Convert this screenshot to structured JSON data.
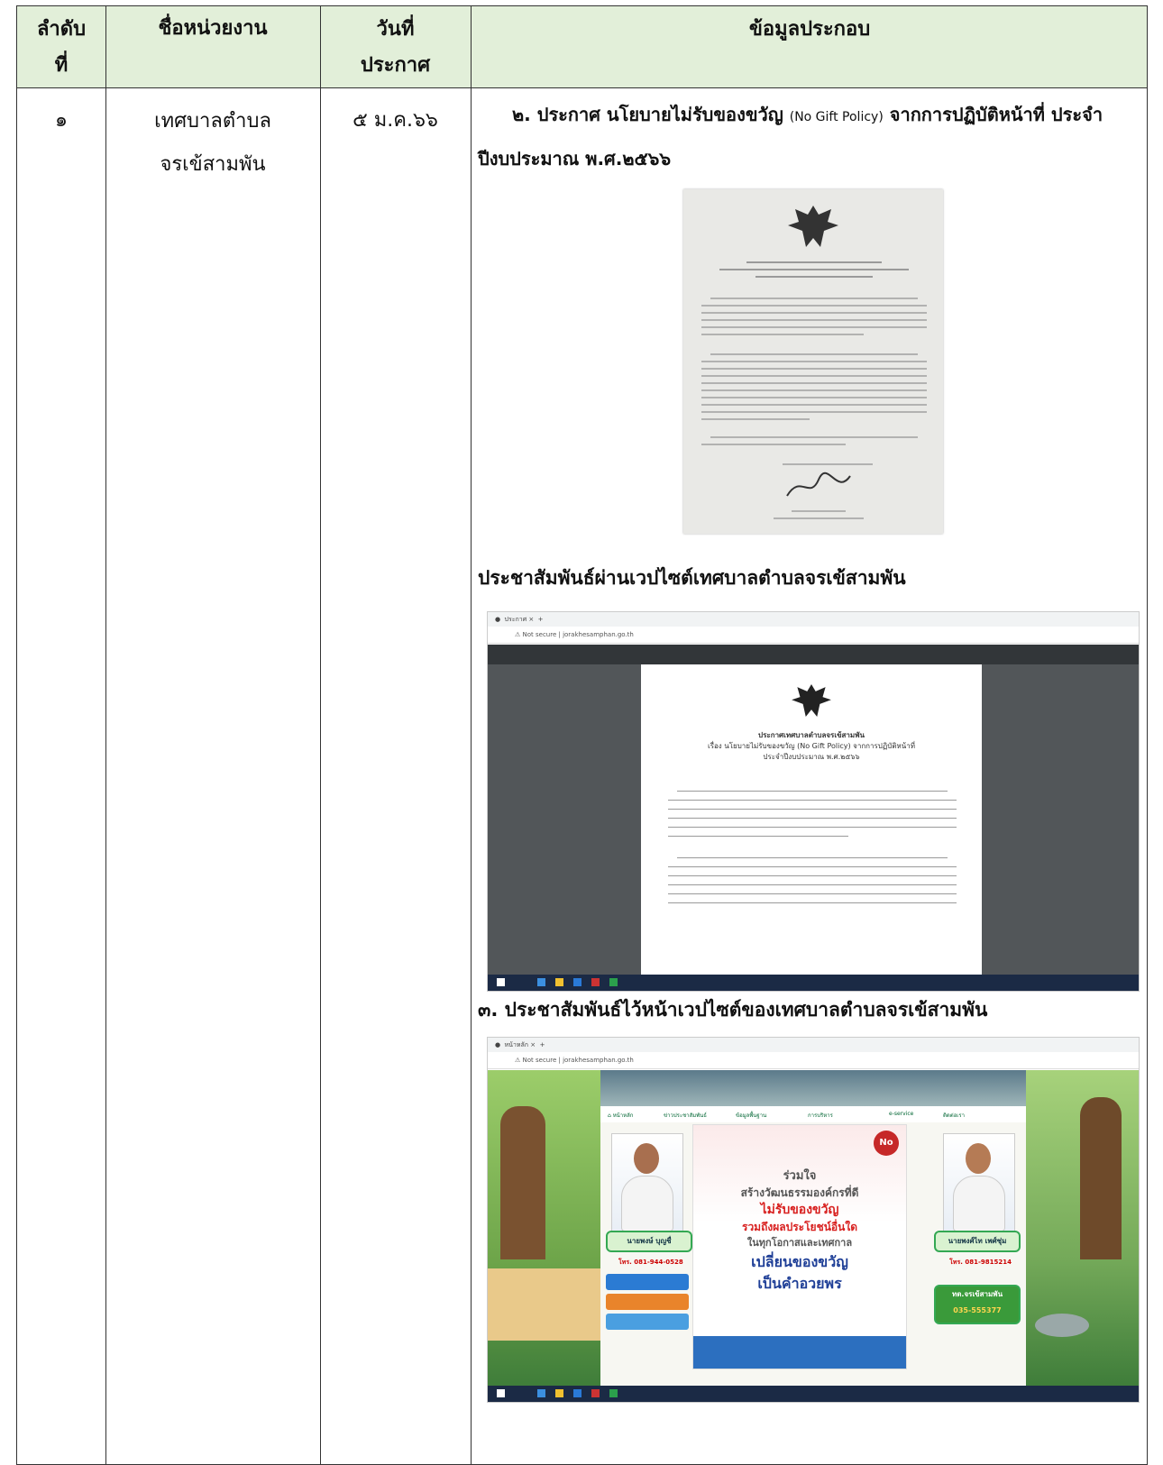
{
  "header": {
    "col1": "ลำดับที่",
    "col2": "ชื่อหน่วยงาน",
    "col3": "วันที่ประกาศ",
    "col4": "ข้อมูลประกอบ"
  },
  "row": {
    "no": "๑",
    "agency_line1": "เทศบาลตำบล",
    "agency_line2": "จรเข้สามพัน",
    "date": "๕ ม.ค.๖๖",
    "item2_a": "๒. ประกาศ นโยบายไม่รับของขวัญ ",
    "item2_b": "(No Gift Policy)",
    "item2_c": " จากการปฏิบัติหน้าที่ ประจำปีงบประมาณ พ.ศ.๒๕๖๖",
    "pr_web": "ประชาสัมพันธ์ผ่านเวปไซต์เทศบาลตำบลจรเข้สามพัน",
    "item3": "๓. ประชาสัมพันธ์ไว้หน้าเวปไซต์ของเทศบาลตำบลจรเข้สามพัน"
  },
  "pdf_shot": {
    "url": "jorakhesamphan.go.th",
    "page_title": "ประกาศเทศบาลตำบลจรเข้สามพัน",
    "page_subject": "เรื่อง นโยบายไม่รับของขวัญ (No Gift Policy) จากการปฏิบัติหน้าที่",
    "page_year": "ประจำปีงบประมาณ พ.ศ.๒๕๖๖"
  },
  "site_shot": {
    "url": "jorakhesamphan.go.th",
    "poster_lines": [
      "ร่วมใจ",
      "สร้างวัฒนธรรมองค์กรที่ดี",
      "ไม่รับของขวัญ",
      "รวมถึงผลประโยชน์อื่นใด",
      "ในทุกโอกาสและเทศกาล",
      "เปลี่ยนของขวัญ",
      "เป็นคำอวยพร"
    ],
    "left_phone": "โทร. 081-944-0528",
    "right_phone": "โทร. 081-9815214",
    "left_name": "นายพงษ์ บุญชื่",
    "right_name": "นายพงศ์ไท เพศ์ชุ่ม",
    "right_box": "ทต.จรเข้สามพัน",
    "right_box_phone": "035-555377"
  },
  "colors": {
    "header_bg": "#e2efd9",
    "poster_red": "#d8201f",
    "poster_blue": "#1f3f97"
  }
}
